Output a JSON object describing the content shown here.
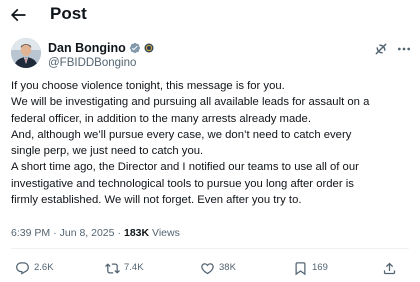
{
  "header": {
    "title": "Post",
    "back_icon": "arrow-left-icon"
  },
  "author": {
    "display_name": "Dan Bongino",
    "handle": "@FBIDDBongino",
    "verified_color": "#829aab"
  },
  "tweet": {
    "lines": [
      "If you choose violence tonight, this message is for you.",
      "We will be investigating and pursuing all available leads for assault on a",
      "federal officer, in addition to the many arrests already made.",
      "And, although we’ll pursue every case, we don’t need to catch every",
      "single perp, we just need to catch you.",
      "A short time ago, the Director and I notified our teams to use all of our",
      "investigative and technological tools to pursue you long after order is",
      "firmly established. We will not forget. Even after you try to."
    ]
  },
  "meta": {
    "time": "6:39 PM",
    "separator": "·",
    "date": "Jun 8, 2025",
    "views_count": "183K",
    "views_label": "Views"
  },
  "actions": {
    "replies": "2.6K",
    "reposts": "7.4K",
    "likes": "38K",
    "bookmarks": "169"
  },
  "colors": {
    "text": "#0f1419",
    "secondary": "#536471",
    "divider": "#eff3f4"
  }
}
